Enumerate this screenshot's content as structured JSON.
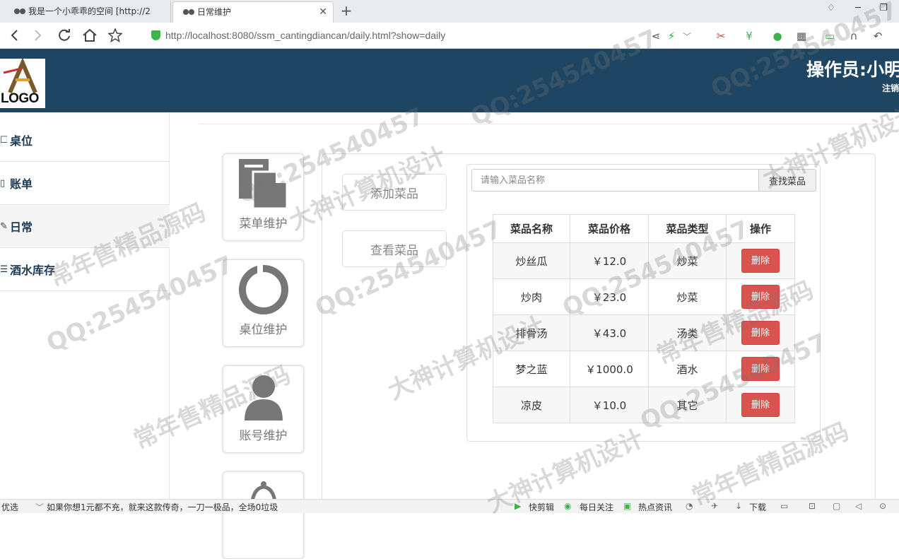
{
  "browser": {
    "tabs": [
      {
        "title": "我是一个小乖乖的空间 [http://2",
        "active": false
      },
      {
        "title": "日常维护",
        "active": true
      }
    ],
    "url_host": "http://localhost",
    "url_rest": ":8080/ssm_cantingdiancan/daily.html?show=daily"
  },
  "header": {
    "logo_text": "LOGO",
    "operator": "操作员:小明",
    "logout": "注销"
  },
  "sidebar": {
    "items": [
      {
        "label": "桌位",
        "icon": "square-icon",
        "active": false
      },
      {
        "label": "账单",
        "icon": "book-icon",
        "active": false
      },
      {
        "label": "日常",
        "icon": "pencil-icon",
        "active": true
      },
      {
        "label": "酒水库存",
        "icon": "list-icon",
        "active": false
      }
    ]
  },
  "modules": [
    {
      "label": "菜单维护",
      "icon": "file-icon"
    },
    {
      "label": "桌位维护",
      "icon": "ring-icon"
    },
    {
      "label": "账号维护",
      "icon": "user-icon"
    },
    {
      "label": "",
      "icon": "bell-icon"
    }
  ],
  "actions": {
    "add": "添加菜品",
    "view": "查看菜品"
  },
  "search": {
    "placeholder": "请输入菜品名称",
    "button": "查找菜品"
  },
  "table": {
    "headers": [
      "菜品名称",
      "菜品价格",
      "菜品类型",
      "操作"
    ],
    "rows": [
      {
        "name": "炒丝瓜",
        "price": "￥12.0",
        "type": "炒菜",
        "action": "删除"
      },
      {
        "name": "炒肉",
        "price": "￥23.0",
        "type": "炒菜",
        "action": "删除"
      },
      {
        "name": "排骨汤",
        "price": "￥43.0",
        "type": "汤类",
        "action": "删除"
      },
      {
        "name": "梦之蓝",
        "price": "￥1000.0",
        "type": "酒水",
        "action": "删除"
      },
      {
        "name": "凉皮",
        "price": "￥10.0",
        "type": "其它",
        "action": "删除"
      }
    ]
  },
  "statusbar": {
    "left": "优选",
    "news": "如果你想1元都不充，就来这款传奇，一刀一极品，全场0垃圾",
    "items": [
      "快剪辑",
      "每日关注",
      "热点资讯",
      "下载"
    ]
  },
  "watermarks": [
    "QQ:254540457",
    "大神计算机设计",
    "常年售精品源码"
  ],
  "colors": {
    "header_bg": "#1e4663",
    "delete_btn": "#d9534f"
  }
}
